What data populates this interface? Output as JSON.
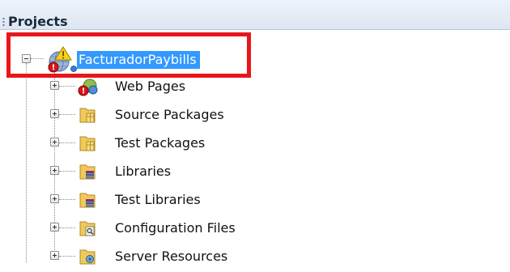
{
  "panel": {
    "title": "Projects"
  },
  "tree": {
    "root": {
      "label": "FacturadorPaybills",
      "expanded": true,
      "icon": "web-project-warning-icon"
    },
    "children": [
      {
        "label": "Web Pages",
        "icon": "web-pages-icon"
      },
      {
        "label": "Source Packages",
        "icon": "source-packages-icon"
      },
      {
        "label": "Test Packages",
        "icon": "test-packages-icon"
      },
      {
        "label": "Libraries",
        "icon": "libraries-icon"
      },
      {
        "label": "Test Libraries",
        "icon": "test-libraries-icon"
      },
      {
        "label": "Configuration Files",
        "icon": "configuration-files-icon"
      },
      {
        "label": "Server Resources",
        "icon": "server-resources-icon"
      }
    ]
  },
  "colors": {
    "selection": "#3399ff",
    "highlight_box": "#e8161b"
  }
}
